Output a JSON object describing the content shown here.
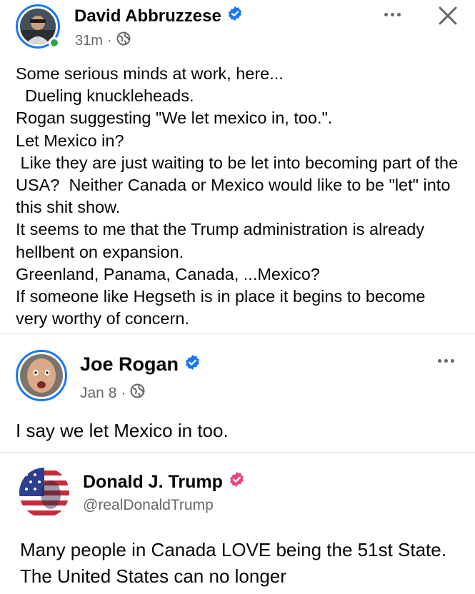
{
  "post": {
    "author": "David Abbruzzese",
    "time": "31m",
    "text": "Some serious minds at work, here...\n  Dueling knuckleheads.\nRogan suggesting \"We let mexico in, too.\".\nLet Mexico in?\n Like they are just waiting to be let into becoming part of the USA?  Neither Canada or Mexico would like to be \"let\" into this shit show.\nIt seems to me that the Trump administration is already hellbent on expansion.\nGreenland, Panama, Canada, ...Mexico?\nIf someone like Hegseth is in place it begins to become very worthy of concern."
  },
  "shared_post": {
    "author": "Joe Rogan",
    "time": "Jan 8",
    "text": "I say we let Mexico in too."
  },
  "embedded_tweet": {
    "author": "Donald J. Trump",
    "handle": "@realDonaldTrump",
    "text": "Many people in Canada LOVE being the 51st State. The United States can no longer"
  },
  "icons": {
    "verified": "verified-badge-icon",
    "audience": "globe-icon",
    "more": "more-options-icon",
    "close": "close-icon"
  },
  "colors": {
    "accent": "#1877f2",
    "online": "#31a24c",
    "secondary_text": "#65676b",
    "truth_badge": "#e8497a"
  }
}
